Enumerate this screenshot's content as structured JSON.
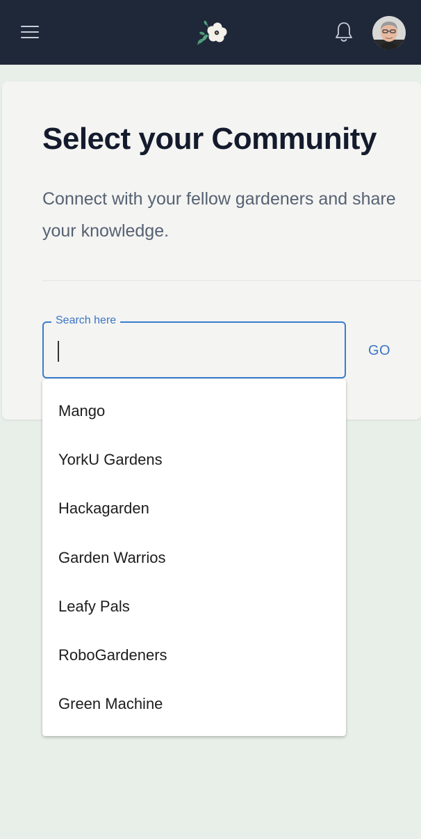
{
  "header": {
    "menu_icon": "hamburger-menu-icon",
    "logo_icon": "flower-logo-icon",
    "notification_icon": "bell-icon",
    "avatar_icon": "user-avatar-icon",
    "background_color": "#1f2839"
  },
  "page": {
    "title": "Select your Community",
    "subtitle": "Connect with your fellow gardeners and share your knowledge."
  },
  "search": {
    "label": "Search here",
    "value": "",
    "placeholder": "",
    "accent_color": "#3a7cd0"
  },
  "go_button": {
    "label": "GO"
  },
  "dropdown": {
    "options": [
      "Mango",
      "YorkU Gardens",
      "Hackagarden",
      "Garden Warrios",
      "Leafy Pals",
      "RoboGardeners",
      "Green Machine"
    ]
  }
}
